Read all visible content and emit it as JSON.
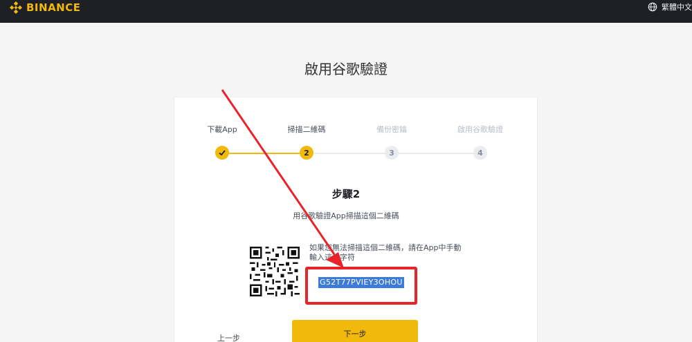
{
  "header": {
    "brand": "BINANCE",
    "language": "繁體中文",
    "icons": {
      "logo": "binance-logo-icon",
      "language": "globe-icon"
    }
  },
  "page": {
    "title": "啟用谷歌驗證"
  },
  "stepper": {
    "steps": [
      {
        "label": "下載App",
        "state": "done",
        "number": ""
      },
      {
        "label": "掃描二維碼",
        "state": "current",
        "number": "2"
      },
      {
        "label": "備份密鑰",
        "state": "todo",
        "number": "3"
      },
      {
        "label": "啟用谷歌驗證",
        "state": "todo",
        "number": "4"
      }
    ]
  },
  "content": {
    "heading": "步驟2",
    "subtitle": "用谷歌驗證App掃描這個二維碼",
    "hint": "如果您無法掃描這個二維碼，請在App中手動輸入這串字符",
    "secret_key": "G52T77PVIEY3OHOU"
  },
  "actions": {
    "prev_label": "上一步",
    "next_label": "下一步"
  },
  "colors": {
    "accent": "#f0b90b",
    "topbar": "#1e2026",
    "annotation": "#e8232a",
    "selection": "#3d7bd9"
  }
}
